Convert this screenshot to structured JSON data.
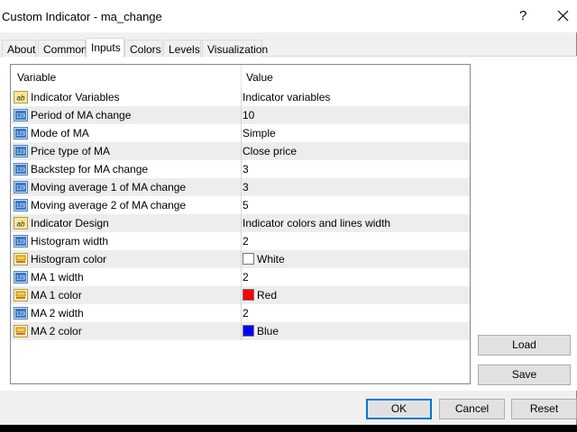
{
  "window": {
    "title": "Custom Indicator - ma_change",
    "help_label": "?"
  },
  "tabs": [
    {
      "label": "About"
    },
    {
      "label": "Common"
    },
    {
      "label": "Inputs"
    },
    {
      "label": "Colors"
    },
    {
      "label": "Levels"
    },
    {
      "label": "Visualization"
    }
  ],
  "active_tab": "Inputs",
  "grid": {
    "col_variable": "Variable",
    "col_value": "Value",
    "rows": [
      {
        "name": "Indicator Variables",
        "value": "Indicator variables",
        "type": "text-icon"
      },
      {
        "name": "Period of MA change",
        "value": "10",
        "type": "number-icon"
      },
      {
        "name": "Mode of MA",
        "value": "Simple",
        "type": "number-icon"
      },
      {
        "name": "Price type of MA",
        "value": "Close price",
        "type": "number-icon"
      },
      {
        "name": "Backstep for MA change",
        "value": "3",
        "type": "number-icon"
      },
      {
        "name": "Moving average 1 of MA change",
        "value": "3",
        "type": "number-icon"
      },
      {
        "name": "Moving average 2 of MA change",
        "value": "5",
        "type": "number-icon"
      },
      {
        "name": "Indicator Design",
        "value": "Indicator colors and lines width",
        "type": "text-icon"
      },
      {
        "name": "Histogram width",
        "value": "2",
        "type": "number-icon"
      },
      {
        "name": "Histogram color",
        "value": "White",
        "type": "color-icon",
        "swatch": "#ffffff"
      },
      {
        "name": "MA 1 width",
        "value": "2",
        "type": "number-icon"
      },
      {
        "name": "MA 1 color",
        "value": "Red",
        "type": "color-icon",
        "swatch": "#ff0000"
      },
      {
        "name": "MA 2 width",
        "value": "2",
        "type": "number-icon"
      },
      {
        "name": "MA 2 color",
        "value": "Blue",
        "type": "color-icon",
        "swatch": "#0000ff"
      }
    ]
  },
  "buttons": {
    "load": "Load",
    "save": "Save",
    "ok": "OK",
    "cancel": "Cancel",
    "reset": "Reset"
  }
}
